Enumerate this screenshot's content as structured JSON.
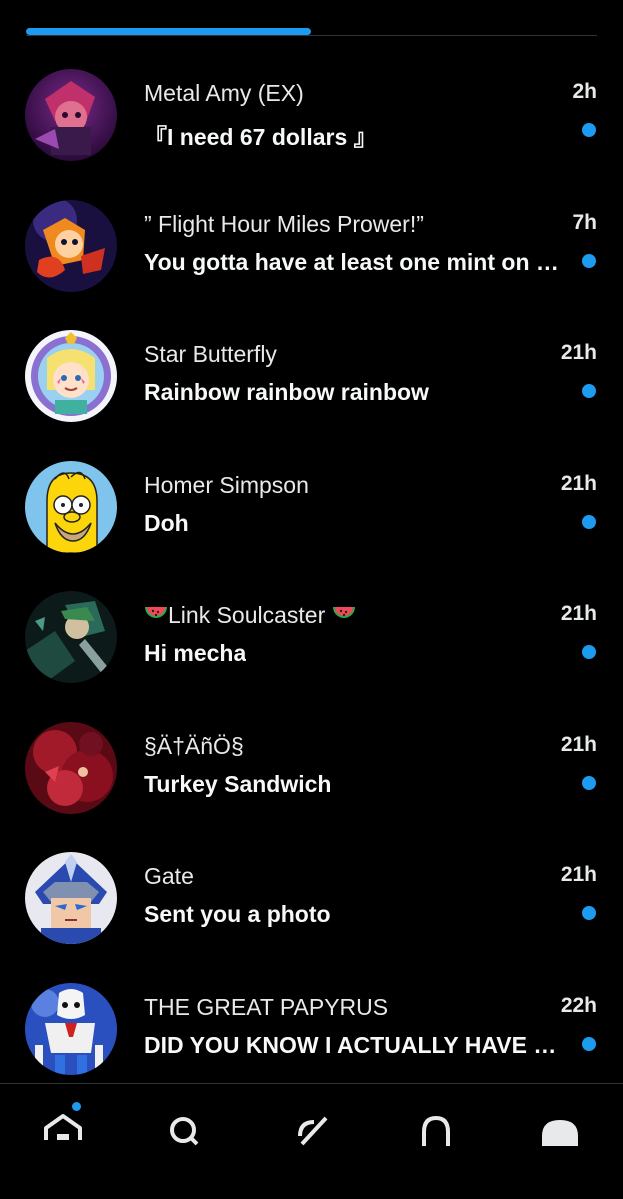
{
  "colors": {
    "accent": "#1d9bf0",
    "background": "#000000",
    "text": "#e7e9ea",
    "divider": "#2f3336"
  },
  "conversations": [
    {
      "name": "Metal Amy (EX)",
      "time": "2h",
      "preview": "『I need 67 dollars 』",
      "unread": true,
      "avatar_icon": "metal-amy-avatar"
    },
    {
      "name": "” Flight Hour Miles Prower!”",
      "time": "7h",
      "preview": "You gotta have at least one mint on …",
      "unread": true,
      "avatar_icon": "tails-avatar"
    },
    {
      "name": "Star Butterfly",
      "time": "21h",
      "preview": "Rainbow rainbow rainbow",
      "unread": true,
      "avatar_icon": "star-butterfly-avatar"
    },
    {
      "name": "Homer Simpson",
      "time": "21h",
      "preview": "Doh",
      "unread": true,
      "avatar_icon": "homer-avatar"
    },
    {
      "name": "Link Soulcaster",
      "time": "21h",
      "preview": "Hi mecha",
      "unread": true,
      "avatar_icon": "link-avatar",
      "name_decoration": "watermelon-emoji"
    },
    {
      "name": "§Ä†ÄñÖ§",
      "time": "21h",
      "preview": "Turkey Sandwich",
      "unread": true,
      "avatar_icon": "satanos-avatar"
    },
    {
      "name": "Gate",
      "time": "21h",
      "preview": "Sent you a photo",
      "unread": true,
      "avatar_icon": "gate-avatar"
    },
    {
      "name": "THE GREAT PAPYRUS",
      "time": "22h",
      "preview": "DID YOU KNOW I ACTUALLY HAVE …",
      "unread": true,
      "avatar_icon": "papyrus-avatar"
    }
  ],
  "bottom_nav": [
    {
      "icon": "home-icon",
      "has_badge": true
    },
    {
      "icon": "search-icon",
      "has_badge": false
    },
    {
      "icon": "grok-icon",
      "has_badge": false
    },
    {
      "icon": "notifications-icon",
      "has_badge": false
    },
    {
      "icon": "messages-icon",
      "has_badge": false
    }
  ]
}
